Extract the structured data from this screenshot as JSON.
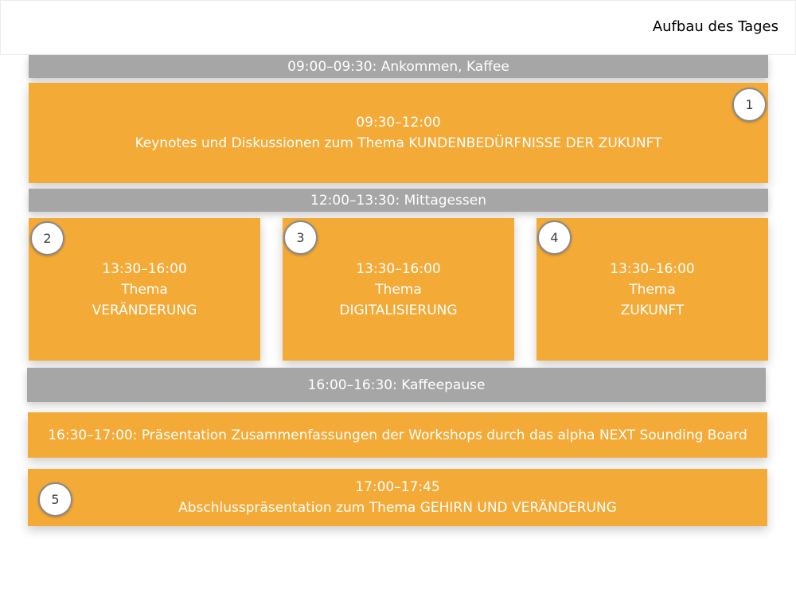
{
  "header": {
    "title": "Aufbau des Tages"
  },
  "colors": {
    "orange": "#f4aa37",
    "gray": "#a6a6a6",
    "badge_border": "#8a8a8a"
  },
  "schedule": {
    "arrival": {
      "text": "09:00–09:30: Ankommen, Kaffee"
    },
    "keynotes": {
      "number": "1",
      "time": "09:30–12:00",
      "title": "Keynotes und Diskussionen zum Thema KUNDENBEDÜRFNISSE DER ZUKUNFT"
    },
    "lunch": {
      "text": "12:00–13:30: Mittagessen"
    },
    "workshops": [
      {
        "number": "2",
        "time": "13:30–16:00",
        "label": "Thema",
        "topic": "VERÄNDERUNG"
      },
      {
        "number": "3",
        "time": "13:30–16:00",
        "label": "Thema",
        "topic": "DIGITALISIERUNG"
      },
      {
        "number": "4",
        "time": "13:30–16:00",
        "label": "Thema",
        "topic": "ZUKUNFT"
      }
    ],
    "coffee_break": {
      "text": "16:00–16:30: Kaffeepause"
    },
    "summary": {
      "text": "16:30–17:00: Präsentation Zusammenfassungen der Workshops durch das alpha NEXT Sounding Board"
    },
    "closing": {
      "number": "5",
      "time": "17:00–17:45",
      "title": "Abschlusspräsentation zum Thema GEHIRN UND VERÄNDERUNG"
    }
  }
}
